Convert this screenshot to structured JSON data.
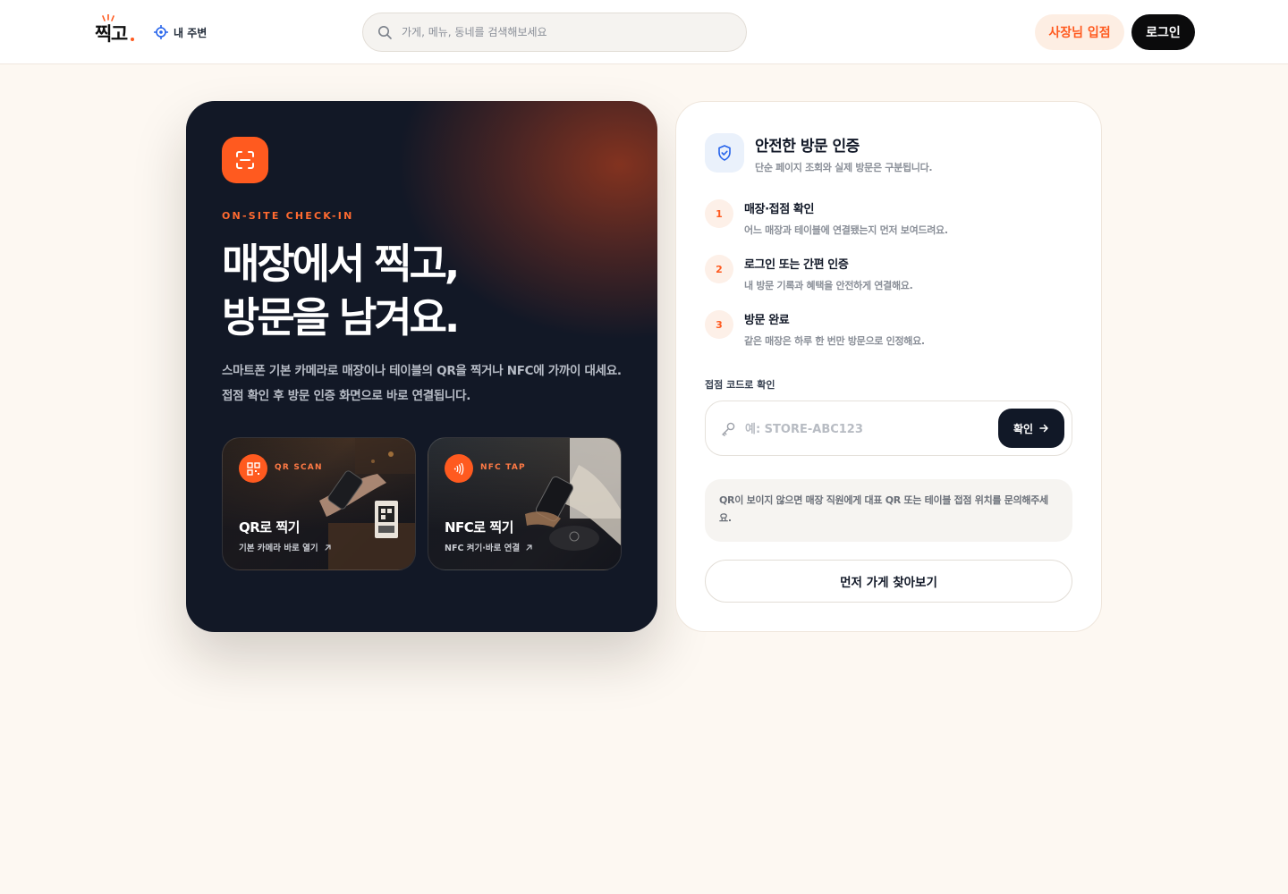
{
  "header": {
    "logo_text": "찍고",
    "location_label": "내 주변",
    "search_placeholder": "가게, 메뉴, 동네를 검색해보세요",
    "owner_button": "사장님 입점",
    "login_button": "로그인"
  },
  "hero": {
    "eyebrow": "ON-SITE CHECK-IN",
    "title_line1": "매장에서 찍고,",
    "title_line2": "방문을 남겨요.",
    "description": "스마트폰 기본 카메라로 매장이나 테이블의 QR을 찍거나 NFC에 가까이 대세요. 접점 확인 후 방문 인증 화면으로 바로 연결됩니다.",
    "methods": [
      {
        "tag": "QR SCAN",
        "title": "QR로 찍기",
        "subtitle": "기본 카메라 바로 열기"
      },
      {
        "tag": "NFC TAP",
        "title": "NFC로 찍기",
        "subtitle": "NFC 켜기·바로 연결"
      }
    ]
  },
  "panel": {
    "title": "안전한 방문 인증",
    "subtitle": "단순 페이지 조회와 실제 방문은 구분됩니다.",
    "steps": [
      {
        "num": "1",
        "title": "매장·접점 확인",
        "desc": "어느 매장과 테이블에 연결됐는지 먼저 보여드려요."
      },
      {
        "num": "2",
        "title": "로그인 또는 간편 인증",
        "desc": "내 방문 기록과 혜택을 안전하게 연결해요."
      },
      {
        "num": "3",
        "title": "방문 완료",
        "desc": "같은 매장은 하루 한 번만 방문으로 인정해요."
      }
    ],
    "code_label": "접점 코드로 확인",
    "code_placeholder": "예: STORE-ABC123",
    "confirm_button": "확인",
    "notice": "QR이 보이지 않으면 매장 직원에게 대표 QR 또는 테이블 접점 위치를 문의해주세요.",
    "browse_button": "먼저 가게 찾아보기"
  },
  "colors": {
    "accent": "#ff5a1f",
    "dark": "#121826",
    "background": "#fdf8f2"
  },
  "icons": {
    "location": "crosshair-icon",
    "search": "search-icon",
    "scan": "scan-frame-icon",
    "qr": "qr-code-icon",
    "nfc": "nfc-waves-icon",
    "shield": "shield-check-icon",
    "key": "key-icon",
    "arrow": "arrow-right-icon",
    "external": "arrow-up-right-icon"
  }
}
